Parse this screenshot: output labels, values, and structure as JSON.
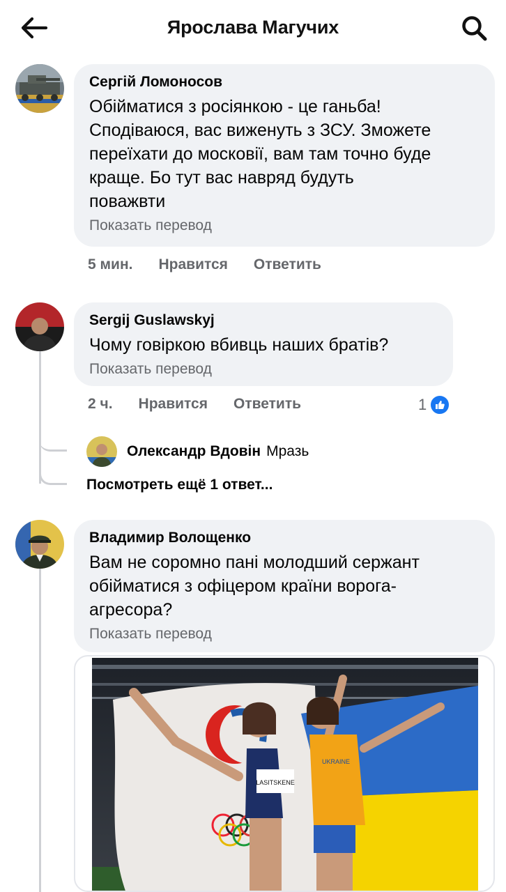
{
  "header": {
    "title": "Ярослава Магучих"
  },
  "comments": [
    {
      "author": "Сергій Ломоносов",
      "lines": [
        "Обійматися з росіянкою - це ганьба!",
        "Сподіваюся, вас виженуть з ЗСУ. Зможете",
        "переїхати до московії, вам там точно буде",
        "краще. Бо тут вас навряд будуть",
        "поважвти"
      ],
      "translate": "Показать перевод",
      "time": "5 мин.",
      "like": "Нравится",
      "reply": "Ответить"
    },
    {
      "author": "Sergij Guslawskyj",
      "lines": [
        "Чому говіркою вбивць наших братів?"
      ],
      "translate": "Показать перевод",
      "time": "2 ч.",
      "like": "Нравится",
      "reply": "Ответить",
      "reactions": "1",
      "reply_preview": {
        "author": "Олександр Вдовін",
        "text": "Мразь"
      },
      "more_replies": "Посмотреть ещё 1 ответ..."
    },
    {
      "author": "Владимир Волощенко",
      "lines": [
        "Вам не соромно пані молодший сержант",
        "обійматися з офіцером країни ворога-",
        "агресора?"
      ],
      "translate": "Показать перевод",
      "photo_bib": "LASITSKENE",
      "photo_shirt": "UKRAINE"
    }
  ],
  "colors": {
    "bubble": "#f0f2f5",
    "meta": "#65676b",
    "accent": "#1877f2",
    "line": "#ced0d4"
  },
  "icons": [
    "back-arrow-icon",
    "search-icon",
    "like-icon"
  ]
}
